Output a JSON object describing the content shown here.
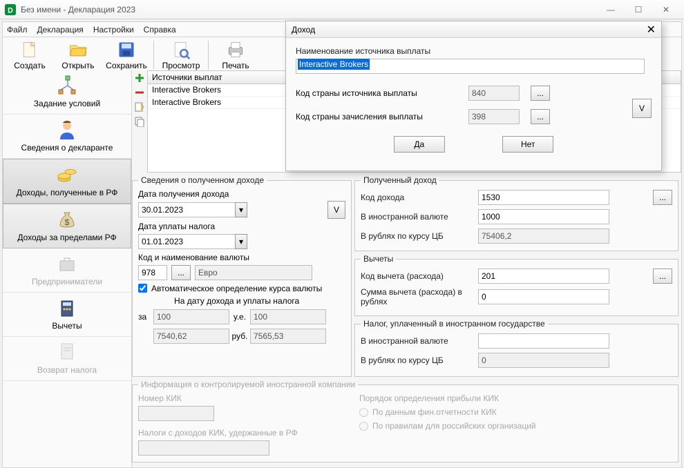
{
  "window": {
    "title": "Без имени - Декларация 2023",
    "min": "—",
    "max": "☐",
    "close": "✕"
  },
  "menubar": {
    "file": "Файл",
    "decl": "Декларация",
    "settings": "Настройки",
    "help": "Справка"
  },
  "toolbar": {
    "create": "Создать",
    "open": "Открыть",
    "save": "Сохранить",
    "preview": "Просмотр",
    "print": "Печать"
  },
  "sidebar": {
    "items": [
      {
        "label": "Задание условий"
      },
      {
        "label": "Сведения о декларанте"
      },
      {
        "label": "Доходы, полученные в РФ"
      },
      {
        "label": "Доходы за пределами РФ"
      },
      {
        "label": "Предприниматели"
      },
      {
        "label": "Вычеты"
      },
      {
        "label": "Возврат налога"
      }
    ]
  },
  "sources": {
    "header": "Источники выплат",
    "rows": [
      "Interactive Brokers",
      "Interactive Brokers"
    ]
  },
  "income_info": {
    "legend": "Сведения о полученном доходе",
    "date_received_label": "Дата получения дохода",
    "date_received": "30.01.2023",
    "v_btn": "V",
    "date_paid_label": "Дата уплаты налога",
    "date_paid": "01.01.2023",
    "currency_label": "Код и наименование валюты",
    "currency_code": "978",
    "currency_name": "Евро",
    "dots": "...",
    "auto_label": "Автоматическое определение курса валюты",
    "auto_sub": "На дату дохода и уплаты налога",
    "za": "за",
    "ue": "у.е.",
    "rub": "руб.",
    "rate1_ue": "100",
    "rate1_rub": "7540,62",
    "rate2_ue": "100",
    "rate2_rub": "7565,53"
  },
  "received": {
    "legend": "Полученный доход",
    "code_label": "Код дохода",
    "code": "1530",
    "foreign_label": "В иностранной валюте",
    "foreign": "1000",
    "rub_label": "В рублях по курсу ЦБ",
    "rub": "75406,2",
    "dots": "..."
  },
  "deductions": {
    "legend": "Вычеты",
    "code_label": "Код вычета (расхода)",
    "code": "201",
    "sum_label": "Сумма вычета (расхода) в рублях",
    "sum": "0",
    "dots": "..."
  },
  "tax_foreign": {
    "legend": "Налог, уплаченный в иностранном государстве",
    "foreign_label": "В иностранной валюте",
    "foreign": "",
    "rub_label": "В рублях по курсу ЦБ",
    "rub": "0"
  },
  "kik": {
    "legend": "Информация о контролируемой иностранной компании",
    "num_label": "Номер КИК",
    "tax_label": "Налоги с доходов КИК, удержанные в РФ",
    "order_label": "Порядок определения прибыли КИК",
    "r1": "По данным фин.отчетности КИК",
    "r2": "По правилам для российских организаций"
  },
  "dialog": {
    "title": "Доход",
    "name_label": "Наименование источника выплаты",
    "name_value": "Interactive Brokers",
    "src_country_label": "Код страны источника выплаты",
    "src_country": "840",
    "credit_country_label": "Код страны зачисления выплаты",
    "credit_country": "398",
    "dots": "...",
    "v_btn": "V",
    "yes": "Да",
    "no": "Нет",
    "close": "✕"
  }
}
